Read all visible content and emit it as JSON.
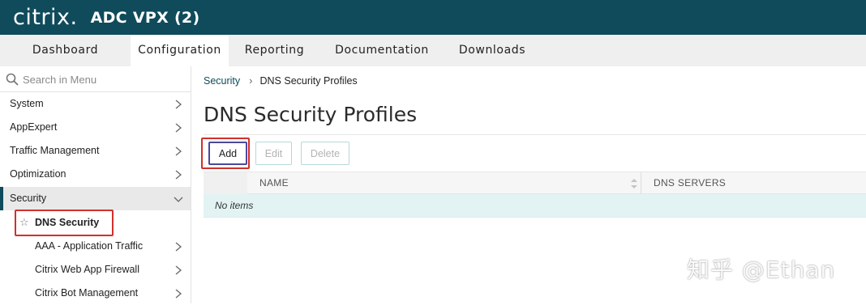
{
  "header": {
    "logo": "citrix.",
    "title": "ADC VPX (2)",
    "bg_color": "#0f4b5b"
  },
  "nav": {
    "tabs": [
      {
        "label": "Dashboard"
      },
      {
        "label": "Configuration",
        "active": true
      },
      {
        "label": "Reporting"
      },
      {
        "label": "Documentation"
      },
      {
        "label": "Downloads"
      }
    ]
  },
  "sidebar": {
    "search_placeholder": "Search in Menu",
    "items": [
      {
        "label": "System"
      },
      {
        "label": "AppExpert"
      },
      {
        "label": "Traffic Management"
      },
      {
        "label": "Optimization"
      },
      {
        "label": "Security",
        "expanded": true
      }
    ],
    "sub_items": [
      {
        "label": "DNS Security",
        "selected": true,
        "star_icon": "star-outline-icon"
      },
      {
        "label": "AAA - Application Traffic"
      },
      {
        "label": "Citrix Web App Firewall"
      },
      {
        "label": "Citrix Bot Management"
      }
    ]
  },
  "breadcrumb": {
    "parent": "Security",
    "current": "DNS Security Profiles"
  },
  "main": {
    "title": "DNS Security Profiles",
    "buttons": {
      "add": "Add",
      "edit": "Edit",
      "delete": "Delete"
    },
    "table": {
      "columns": [
        "NAME",
        "DNS SERVERS"
      ],
      "empty_text": "No items"
    }
  },
  "watermark": "知乎 @Ethan",
  "colors": {
    "accent": "#0f4b5b",
    "highlight_box": "#d0312d",
    "empty_row_bg": "#e3f3f3"
  }
}
